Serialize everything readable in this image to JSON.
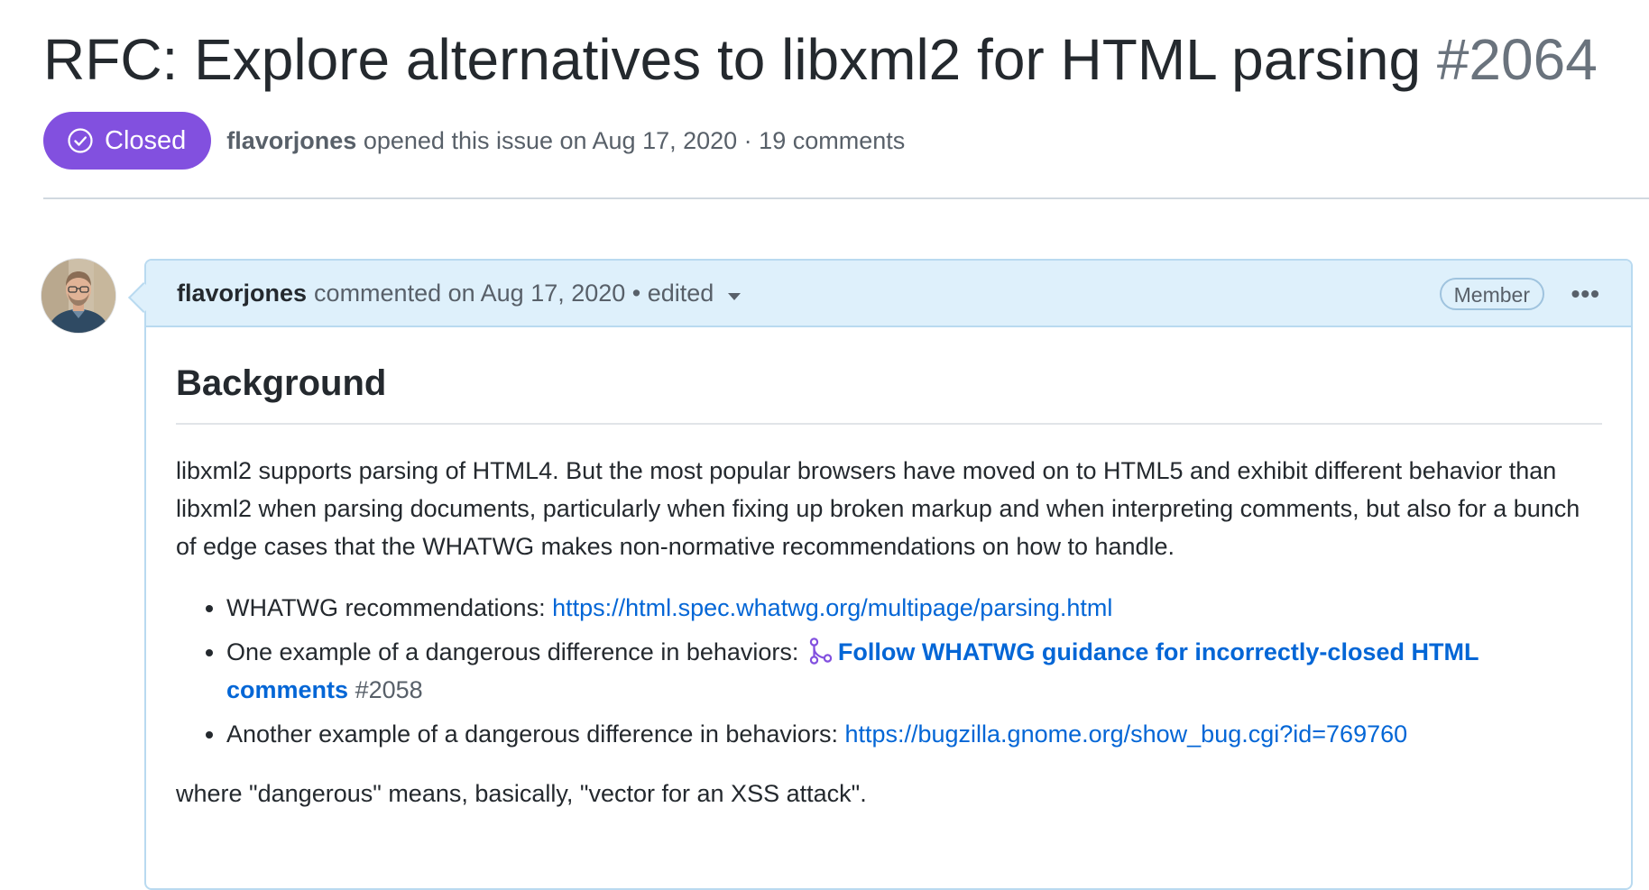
{
  "issue": {
    "title": "RFC: Explore alternatives to libxml2 for HTML parsing",
    "number": "#2064",
    "state": "Closed",
    "state_color": "#8250df",
    "author": "flavorjones",
    "meta": "opened this issue on Aug 17, 2020 · 19 comments"
  },
  "comment": {
    "author": "flavorjones",
    "action": "commented on Aug 17, 2020 • edited",
    "role": "Member",
    "menu": "•••",
    "heading": "Background",
    "paragraph": "libxml2 supports parsing of HTML4. But the most popular browsers have moved on to HTML5 and exhibit different behavior than libxml2 when parsing documents, particularly when fixing up broken markup and when interpreting comments, but also for a bunch of edge cases that the WHATWG makes non-normative recommendations on how to handle.",
    "bullets": [
      {
        "text": "WHATWG recommendations: ",
        "link": "https://html.spec.whatwg.org/multipage/parsing.html"
      },
      {
        "text": "One example of a dangerous difference in behaviors: ",
        "pr_title": "Follow WHATWG guidance for incorrectly-closed HTML comments",
        "pr_number": "#2058"
      },
      {
        "text": "Another example of a dangerous difference in behaviors: ",
        "link": "https://bugzilla.gnome.org/show_bug.cgi?id=769760"
      }
    ],
    "closing": "where \"dangerous\" means, basically, \"vector for an XSS attack\"."
  },
  "icons": {
    "state": "check-circle-icon",
    "pr": "git-pull-request-icon",
    "menu": "kebab-horizontal-icon",
    "caret": "triangle-down-icon"
  },
  "colors": {
    "link": "#0366d6",
    "header_bg": "#def0fb",
    "header_border": "#b9daf0"
  }
}
